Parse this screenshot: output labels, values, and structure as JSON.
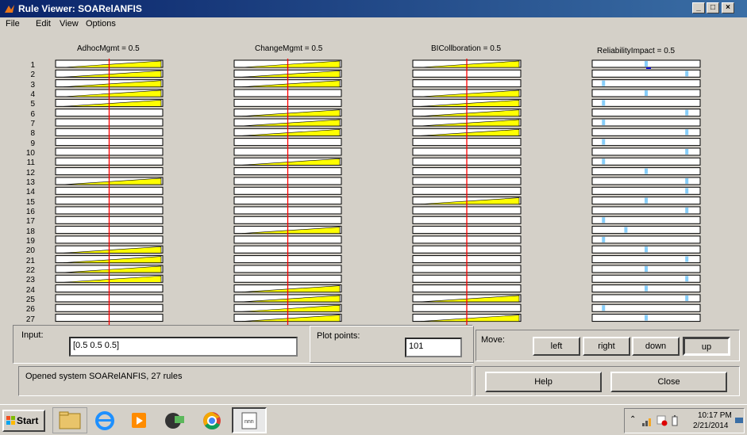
{
  "window": {
    "title": "Rule Viewer: SOARelANFIS"
  },
  "menu": [
    "File",
    "Edit",
    "View",
    "Options"
  ],
  "variables": [
    {
      "label": "AdhocMgmt = 0.5"
    },
    {
      "label": "ChangeMgmt = 0.5"
    },
    {
      "label": "BICollboration = 0.5"
    },
    {
      "label": "ReliabilityImpact = 0.5"
    }
  ],
  "rule_numbers": [
    "1",
    "2",
    "3",
    "4",
    "5",
    "6",
    "7",
    "8",
    "9",
    "10",
    "11",
    "12",
    "13",
    "14",
    "15",
    "16",
    "17",
    "18",
    "19",
    "20",
    "21",
    "22",
    "23",
    "24",
    "25",
    "26",
    "27"
  ],
  "input": {
    "label": "Input:",
    "value": "[0.5 0.5 0.5]"
  },
  "plot_points": {
    "label": "Plot points:",
    "value": "101"
  },
  "move": {
    "label": "Move:",
    "buttons": [
      "left",
      "right",
      "down",
      "up"
    ]
  },
  "status": {
    "text": "Opened system SOARelANFIS, 27 rules"
  },
  "buttons": {
    "help": "Help",
    "close": "Close"
  },
  "taskbar": {
    "start": "Start",
    "time": "10:17 PM",
    "date": "2/21/2014"
  },
  "colors": {
    "titlebar": "#0a246a",
    "input_line": "#ff0000",
    "membership_fill": "#ffff00",
    "output_marker": "#87cefa"
  }
}
